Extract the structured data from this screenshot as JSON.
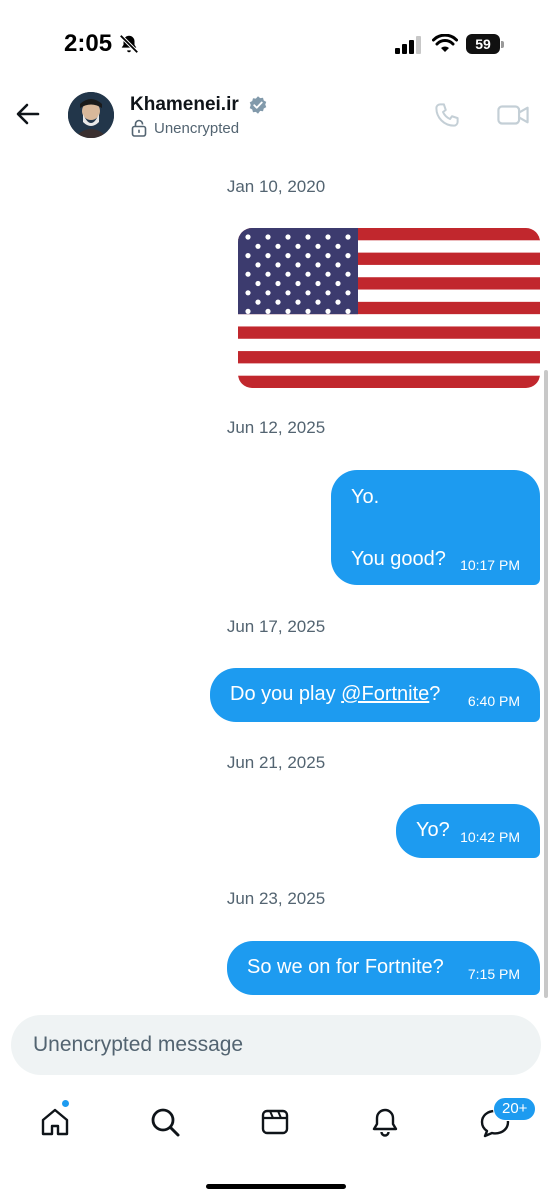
{
  "status_bar": {
    "time": "2:05",
    "battery": "59"
  },
  "header": {
    "name": "Khamenei.ir",
    "encryption_status": "Unencrypted"
  },
  "messages": {
    "sep1": "Jan 10, 2020",
    "sep2": "Jun 12, 2025",
    "msg1_text": "Yo.\n\nYou good?",
    "msg1_time": "10:17 PM",
    "sep3": "Jun 17, 2025",
    "msg2_prefix": "Do you play ",
    "msg2_mention": "@Fortnite",
    "msg2_suffix": "?",
    "msg2_time": "6:40 PM",
    "sep4": "Jun 21, 2025",
    "msg3_text": "Yo?",
    "msg3_time": "10:42 PM",
    "sep5": "Jun 23, 2025",
    "msg4_text": "So we on for Fortnite?",
    "msg4_time": "7:15 PM"
  },
  "composer": {
    "placeholder": "Unencrypted message"
  },
  "nav": {
    "messages_badge": "20+"
  },
  "colors": {
    "accent": "#1d9bf0",
    "secondary_text": "#536471",
    "input_bg": "#eff3f4"
  },
  "icons": [
    "bell-off-icon",
    "signal-icon",
    "wifi-icon",
    "battery-icon",
    "back-arrow-icon",
    "verified-icon",
    "lock-icon",
    "phone-icon",
    "video-icon",
    "home-icon",
    "search-icon",
    "media-icon",
    "bell-icon",
    "messages-icon"
  ]
}
